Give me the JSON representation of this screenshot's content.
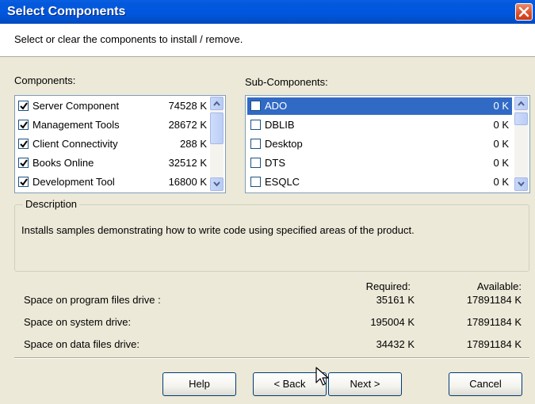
{
  "window": {
    "title": "Select Components"
  },
  "header": {
    "instruction": "Select or clear the components to install / remove."
  },
  "components": {
    "label": "Components:",
    "items": [
      {
        "name": "Server Component",
        "size": "74528 K",
        "checked": true
      },
      {
        "name": "Management Tools",
        "size": "28672 K",
        "checked": true
      },
      {
        "name": "Client Connectivity",
        "size": "288 K",
        "checked": true
      },
      {
        "name": "Books Online",
        "size": "32512 K",
        "checked": true
      },
      {
        "name": "Development Tool",
        "size": "16800 K",
        "checked": true
      }
    ]
  },
  "subcomponents": {
    "label": "Sub-Components:",
    "items": [
      {
        "name": "ADO",
        "size": "0 K",
        "checked": false,
        "selected": true
      },
      {
        "name": "DBLIB",
        "size": "0 K",
        "checked": false
      },
      {
        "name": "Desktop",
        "size": "0 K",
        "checked": false
      },
      {
        "name": "DTS",
        "size": "0 K",
        "checked": false
      },
      {
        "name": "ESQLC",
        "size": "0 K",
        "checked": false
      }
    ]
  },
  "description": {
    "legend": "Description",
    "text": "Installs samples demonstrating how to write code using specified areas of the product."
  },
  "space": {
    "required_header": "Required:",
    "available_header": "Available:",
    "rows": [
      {
        "label": "Space on program files drive :",
        "required": "35161 K",
        "available": "17891184 K"
      },
      {
        "label": "Space on system drive:",
        "required": "195004 K",
        "available": "17891184 K"
      },
      {
        "label": "Space on data files drive:",
        "required": "34432 K",
        "available": "17891184 K"
      }
    ]
  },
  "buttons": {
    "help": "Help",
    "back": "< Back",
    "next": "Next >",
    "cancel": "Cancel"
  },
  "colors": {
    "titlebar": "#0058e2",
    "selection": "#316ac5",
    "dialog_bg": "#ece9d8"
  },
  "icons": {
    "close": "close-icon",
    "scroll_up": "scroll-up-arrow-icon",
    "scroll_down": "scroll-down-arrow-icon",
    "cursor": "mouse-pointer-icon"
  }
}
